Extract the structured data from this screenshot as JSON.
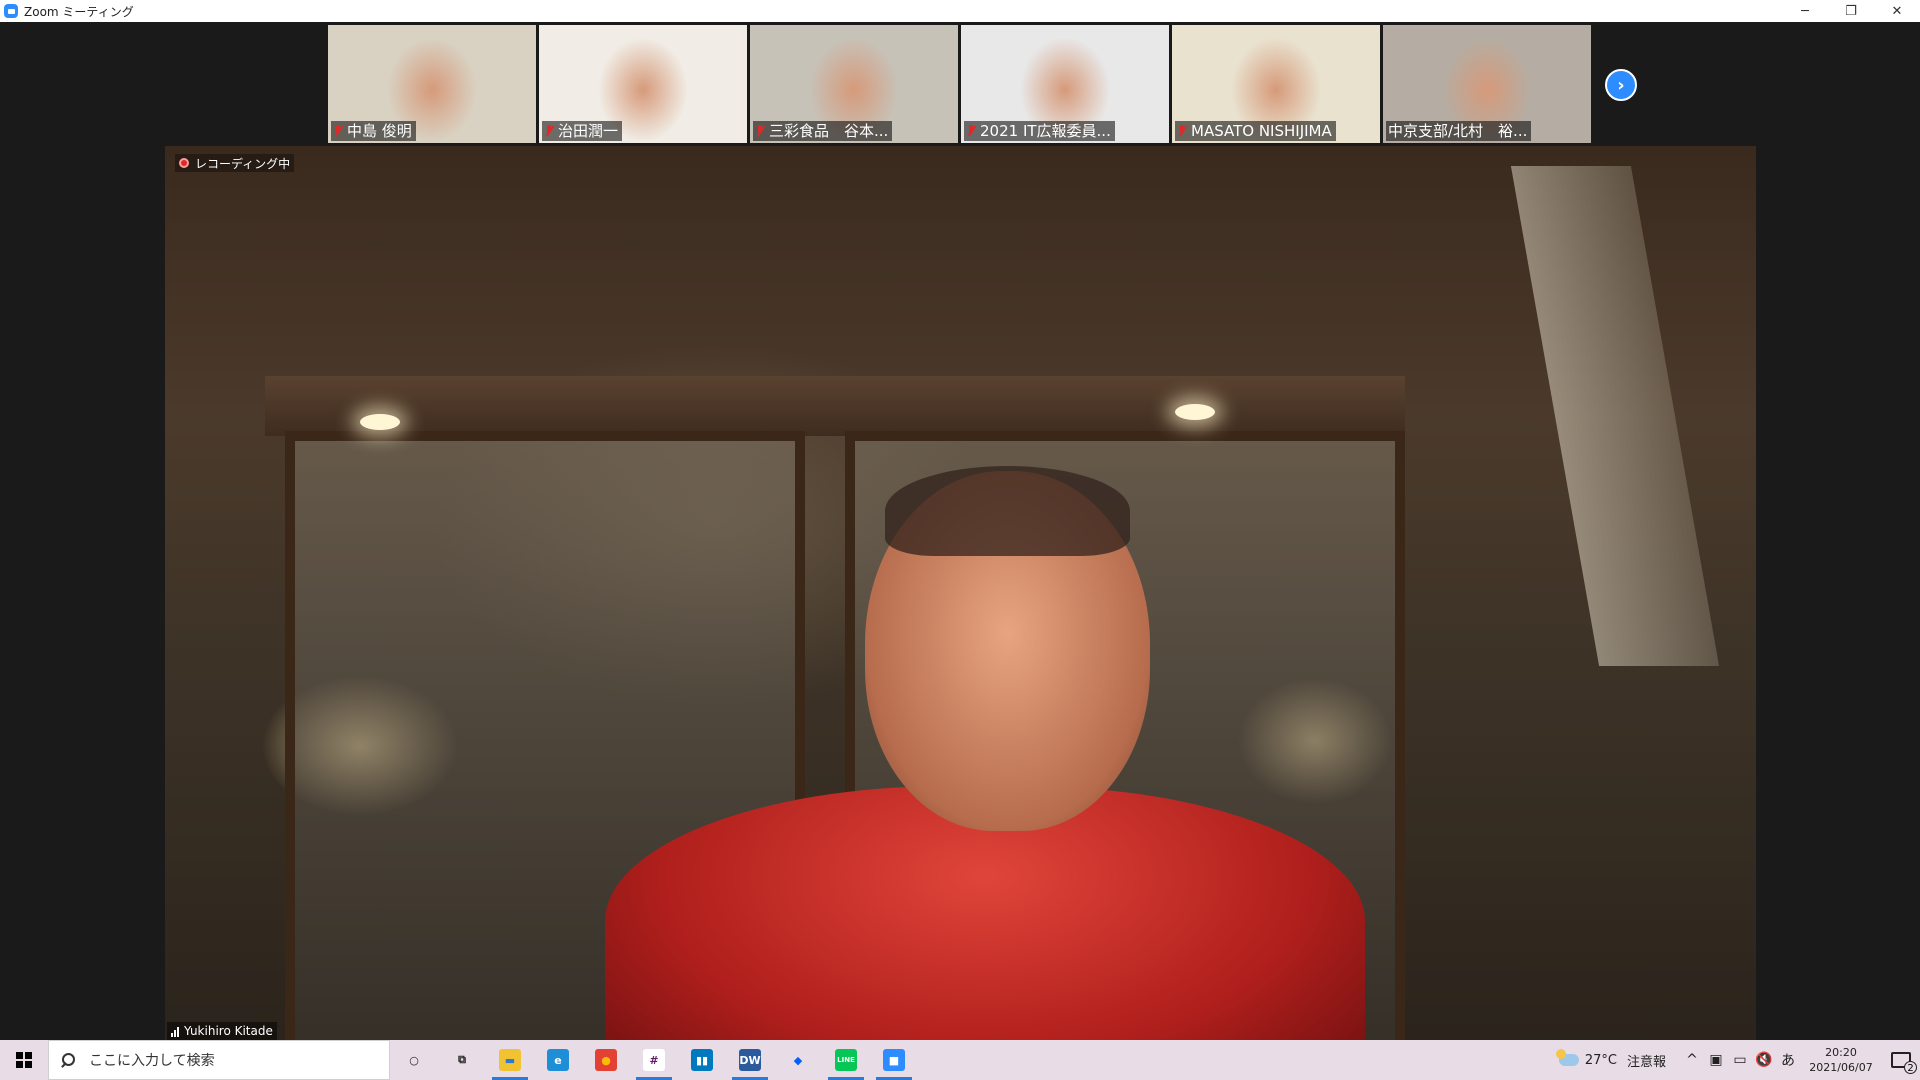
{
  "window": {
    "title": "Zoom ミーティング",
    "controls": [
      "─",
      "❐",
      "✕"
    ]
  },
  "thumbnails": [
    {
      "name": "中島 俊明",
      "muted": true,
      "bg": "#d9d2c3"
    },
    {
      "name": "治田潤一",
      "muted": true,
      "bg": "#f1ede6"
    },
    {
      "name": "三彩食品　谷本...",
      "muted": true,
      "bg": "#c7c2b8"
    },
    {
      "name": "2021 IT広報委員...",
      "muted": true,
      "bg": "#e8e8e8"
    },
    {
      "name": "MASATO NISHIJIMA",
      "muted": true,
      "bg": "#e9e2cf"
    },
    {
      "name": "中京支部/北村　裕...",
      "muted": false,
      "bg": "#b5ada3"
    }
  ],
  "speaker": {
    "recording_label": "レコーディング中",
    "name": "Yukihiro Kitade"
  },
  "taskbar": {
    "search_placeholder": "ここに入力して検索",
    "apps": [
      {
        "name": "cortana-icon",
        "glyph": "○",
        "color": "transparent",
        "fg": "#222",
        "active": false
      },
      {
        "name": "task-view-icon",
        "glyph": "⧉",
        "color": "transparent",
        "fg": "#222",
        "active": false
      },
      {
        "name": "file-explorer-icon",
        "glyph": "▬",
        "color": "#f1c232",
        "fg": "#2b7bd6",
        "active": true
      },
      {
        "name": "edge-icon",
        "glyph": "e",
        "color": "#1e8ed6",
        "fg": "#fff",
        "active": false
      },
      {
        "name": "chrome-icon",
        "glyph": "●",
        "color": "#e34133",
        "fg": "#fbbc05",
        "active": false
      },
      {
        "name": "slack-icon",
        "glyph": "#",
        "color": "#ffffff",
        "fg": "#611f69",
        "active": true
      },
      {
        "name": "trello-icon",
        "glyph": "▮▮",
        "color": "#0079bf",
        "fg": "#fff",
        "active": false
      },
      {
        "name": "dreamweaver-icon",
        "glyph": "DW",
        "color": "#2b5b9c",
        "fg": "#fff",
        "active": true
      },
      {
        "name": "dropbox-icon",
        "glyph": "◆",
        "color": "transparent",
        "fg": "#0061ff",
        "active": false
      },
      {
        "name": "line-icon",
        "glyph": "LINE",
        "color": "#06c755",
        "fg": "#fff",
        "active": true
      },
      {
        "name": "zoom-icon",
        "glyph": "■",
        "color": "#2d8cff",
        "fg": "#fff",
        "active": true
      }
    ],
    "weather": {
      "temp": "27°C",
      "label": "注意報"
    },
    "tray_icons": [
      "^",
      "▣",
      "▭",
      "🔇",
      "あ"
    ],
    "time": "20:20",
    "date": "2021/06/07",
    "notification_count": "2"
  }
}
